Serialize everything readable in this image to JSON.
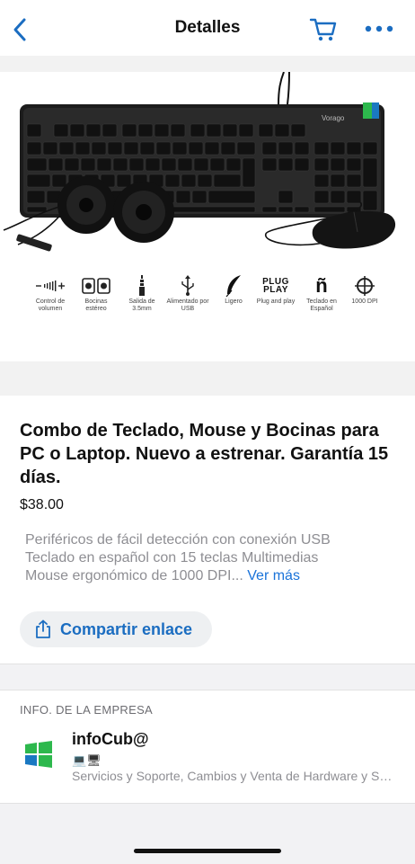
{
  "nav": {
    "title": "Detalles"
  },
  "product": {
    "brand": "Vorago",
    "features": [
      {
        "icon": "volume-control-icon",
        "label": "Control de volumen"
      },
      {
        "icon": "stereo-speakers-icon",
        "label": "Bocinas estéreo"
      },
      {
        "icon": "audio-jack-icon",
        "label": "Salida de 3.5mm"
      },
      {
        "icon": "usb-icon",
        "label": "Alimentado por USB"
      },
      {
        "icon": "feather-icon",
        "label": "Ligero"
      },
      {
        "icon": "plug-and-play-icon",
        "label": "Plug and play",
        "glyph": "PLUG PLAY"
      },
      {
        "icon": "spanish-keyboard-icon",
        "label": "Teclado en Español",
        "glyph": "ñ"
      },
      {
        "icon": "crosshair-icon",
        "label": "1000 DPI"
      }
    ],
    "title": "Combo de Teclado, Mouse y Bocinas para PC o Laptop. Nuevo a estrenar. Garantía 15 días.",
    "price": "$38.00",
    "description_line1": "Periféricos de fácil detección con conexión USB",
    "description_line2": "Teclado en español con 15 teclas Multimedias",
    "description_line3": "Mouse ergonómico de 1000 DPI...",
    "see_more": "Ver más",
    "share_label": "Compartir enlace"
  },
  "company": {
    "section_header": "INFO. DE LA EMPRESA",
    "name": "infoCub@",
    "emoji_line": "💻🖥",
    "description": "Servicios y Soporte, Cambios y Venta de Hardware y Software"
  },
  "colors": {
    "accent": "#1b6dc1",
    "link": "#1a73d9",
    "secondary_text": "#8e8e93",
    "logo_green": "#2db84d",
    "logo_blue": "#1a78c2"
  }
}
